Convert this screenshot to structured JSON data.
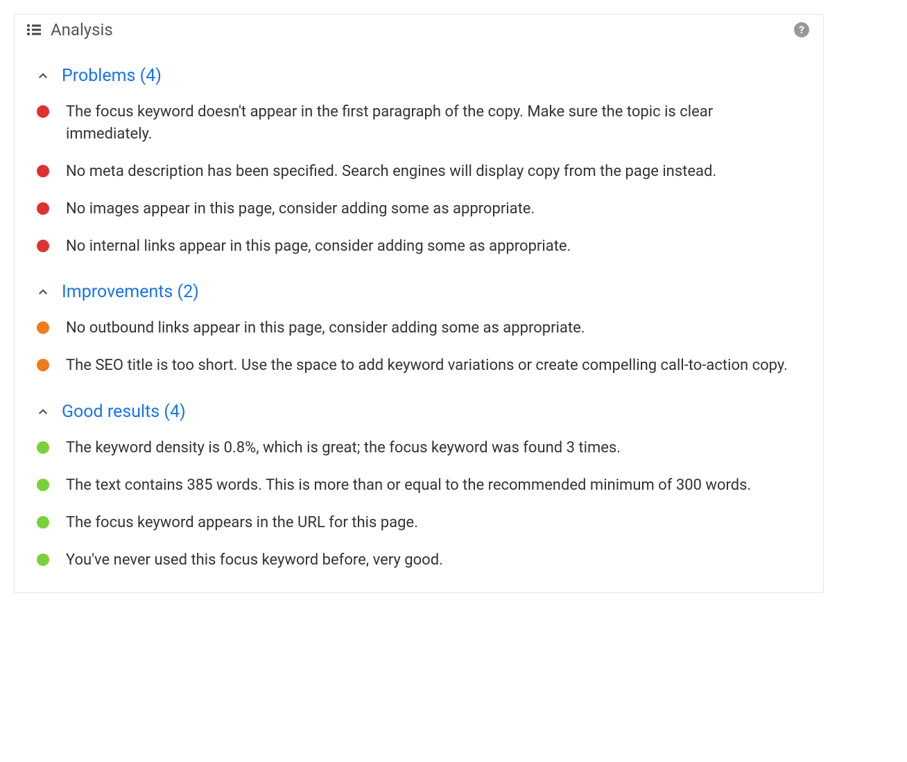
{
  "header": {
    "title": "Analysis",
    "help": "?"
  },
  "sections": [
    {
      "title": "Problems (4)",
      "color": "red",
      "items": [
        "The focus keyword doesn't appear in the first paragraph of the copy. Make sure the topic is clear immediately.",
        "No meta description has been specified. Search engines will display copy from the page instead.",
        "No images appear in this page, consider adding some as appropriate.",
        "No internal links appear in this page, consider adding some as appropriate."
      ]
    },
    {
      "title": "Improvements (2)",
      "color": "orange",
      "items": [
        "No outbound links appear in this page, consider adding some as appropriate.",
        "The SEO title is too short. Use the space to add keyword variations or create compelling call-to-action copy."
      ]
    },
    {
      "title": "Good results (4)",
      "color": "green",
      "items": [
        "The keyword density is 0.8%, which is great; the focus keyword was found 3 times.",
        "The text contains 385 words. This is more than or equal to the recommended minimum of 300 words.",
        "The focus keyword appears in the URL for this page.",
        "You've never used this focus keyword before, very good."
      ]
    }
  ]
}
